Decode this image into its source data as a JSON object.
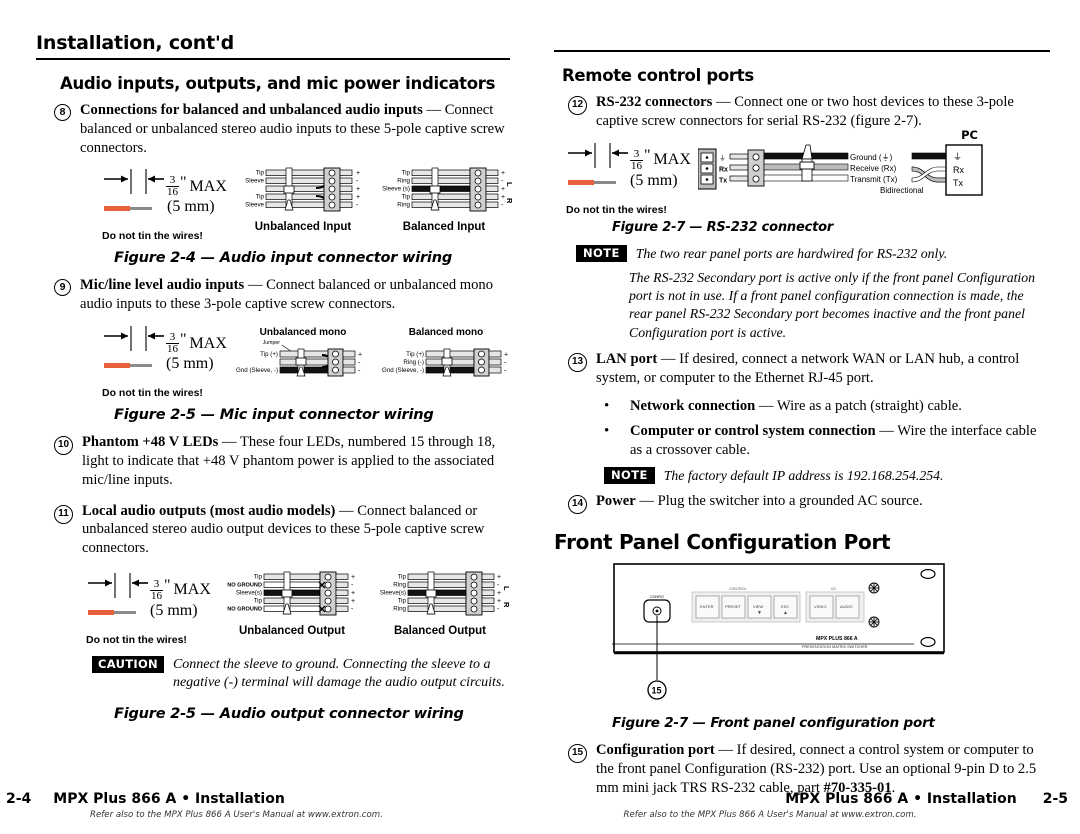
{
  "document": {
    "title": "Installation, cont'd",
    "product": "MPX Plus 866 A"
  },
  "left_page": {
    "header": "Installation, cont'd",
    "section_heading": "Audio inputs, outputs, and mic power indicators",
    "items": [
      {
        "number": "8",
        "bold": "Connections for balanced and unbalanced audio inputs",
        "dash": " — ",
        "rest": "Connect balanced or unbalanced stereo audio inputs to these 5-pole captive screw connectors."
      },
      {
        "number": "9",
        "bold": "Mic/line level audio inputs",
        "dash": " — ",
        "rest": "Connect balanced or unbalanced mono audio inputs to these 3-pole captive screw connectors."
      },
      {
        "number": "10",
        "bold": "Phantom +48 V LEDs",
        "dash": " — ",
        "rest": "These four LEDs, numbered 15 through 18, light to indicate that +48 V phantom power is applied to the associated mic/line inputs."
      },
      {
        "number": "11",
        "bold": "Local audio outputs (most audio models)",
        "dash": " — ",
        "rest": "Connect balanced or unbalanced stereo audio output devices to these 5-pole captive screw connectors."
      }
    ],
    "strip_figure": {
      "fraction_num": "3",
      "fraction_den": "16",
      "inch_mark": "\"",
      "max_label": "MAX",
      "mm_label": "(5 mm)",
      "warning": "Do not tin the wires!"
    },
    "fig_audio_in": {
      "caption": "Figure 2-4 — Audio input connector wiring",
      "left_title": "Unbalanced Input",
      "right_title": "Balanced Input",
      "unbalanced_labels": [
        "Tip",
        "Sleeve",
        "",
        "Tip",
        "Sleeve"
      ],
      "balanced_labels": [
        "Tip",
        "Ring",
        "Sleeve (s)",
        "Tip",
        "Ring"
      ],
      "signs": [
        "+",
        "-",
        "+",
        "+",
        "-"
      ],
      "channels": [
        "L",
        "R"
      ]
    },
    "fig_mic_in": {
      "caption": "Figure 2-5 — Mic input connector wiring",
      "left_title": "Unbalanced mono",
      "right_title": "Balanced mono",
      "jumper_label": "Jumper",
      "unbalanced_labels": [
        "Tip (+)",
        "",
        "Gnd (Sleeve, -)"
      ],
      "balanced_labels": [
        "Tip (+)",
        "Ring (-)",
        "Gnd (Sleeve, -)"
      ],
      "signs": [
        "+",
        "-",
        "-"
      ]
    },
    "fig_audio_out": {
      "caption": "Figure 2-5 — Audio output connector wiring",
      "left_title": "Unbalanced Output",
      "right_title": "Balanced Output",
      "unbalanced_labels": [
        "Tip",
        "NO GROUND",
        "Sleeve(s)",
        "Tip",
        "NO GROUND"
      ],
      "balanced_labels": [
        "Tip",
        "Ring",
        "Sleeve(s)",
        "Tip",
        "Ring"
      ],
      "signs": [
        "+",
        "-",
        "+",
        "+",
        "-"
      ],
      "channels": [
        "L",
        "R"
      ]
    },
    "caution": {
      "badge": "CAUTION",
      "text": "Connect the sleeve to ground.  Connecting the sleeve to a negative (-) terminal will damage the audio output circuits."
    },
    "footer": {
      "page": "2-4",
      "title": "MPX Plus 866 A • Installation",
      "subtitle": "Refer also to the MPX Plus 866 A User's Manual at www.extron.com."
    }
  },
  "right_page": {
    "section_heading": "Remote control ports",
    "items": [
      {
        "number": "12",
        "bold": "RS-232 connectors",
        "dash": " — ",
        "rest": "Connect one or two host devices to these 3-pole captive screw connectors for serial RS-232 (figure 2-7)."
      },
      {
        "number": "13",
        "bold": "LAN port",
        "dash": " — ",
        "rest": "If desired, connect a network WAN or LAN hub, a control system, or computer to the Ethernet RJ-45 port."
      },
      {
        "number": "14",
        "bold": "Power",
        "dash": " — ",
        "rest": "Plug the switcher into a grounded AC source."
      }
    ],
    "fig_rs232": {
      "caption": "Figure 2-7 — RS-232 connector",
      "pc_label": "PC",
      "pin_labels": [
        "⏚",
        "Rx",
        "Tx"
      ],
      "wire_labels": [
        "Ground (⏚)",
        "Receive (Rx)",
        "Transmit (Tx)"
      ],
      "bidirectional": "Bidirectional",
      "pc_pins": [
        "⏚",
        "Rx",
        "Tx"
      ],
      "strip": {
        "fraction_num": "3",
        "fraction_den": "16",
        "inch_mark": "\"",
        "max_label": "MAX",
        "mm_label": "(5 mm)",
        "warning": "Do not tin the wires!"
      }
    },
    "note_rs232": {
      "badge": "NOTE",
      "text": "The two rear panel ports are hardwired for RS-232 only.",
      "body": "The RS-232 Secondary port is active only if the front panel Configuration port is not in use.  If a front panel configuration connection is made, the rear panel RS-232 Secondary port becomes inactive and the front panel Configuration port is active."
    },
    "lan_bullets": [
      {
        "bold": "Network connection",
        "dash": " — ",
        "rest": "Wire as a patch (straight) cable."
      },
      {
        "bold": "Computer or control system connection",
        "dash": " — ",
        "rest": "Wire the interface cable as a crossover cable."
      }
    ],
    "note_ip": {
      "badge": "NOTE",
      "text": "The factory default IP address is 192.168.254.254."
    },
    "front_panel_heading": "Front Panel Configuration Port",
    "fig_front_panel": {
      "caption": "Figure 2-7 — Front panel configuration port",
      "callout": "15",
      "config_label": "CONFIG",
      "group_left_label": "CONTROL",
      "group_right_label": "I/O",
      "buttons": [
        "ENTER",
        "PRESET",
        "VIEW",
        "ESC"
      ],
      "buttons_io": [
        "VIDEO",
        "AUDIO"
      ],
      "model_line1": "MPX PLUS 866 A",
      "model_line2": "PRESENTATION MATRIX SWITCHER"
    },
    "item_config": {
      "number": "15",
      "bold": "Configuration port",
      "dash": " — ",
      "rest_a": "If desired, connect a control system or computer to the front panel Configuration (RS-232) port. Use an optional 9-pin D to 2.5 mm mini jack TRS RS-232 cable, part ",
      "part_number": "#70-335-01",
      "rest_b": "."
    },
    "footer": {
      "page": "2-5",
      "title": "MPX Plus 866 A • Installation",
      "subtitle": "Refer also to the MPX Plus 866 A User's Manual at www.extron.com."
    }
  },
  "colors": {
    "wire_red": "#e8603c",
    "ink": "#000000",
    "gray_body": "#d8d8d8",
    "gray_dark": "#9a9a9a"
  }
}
